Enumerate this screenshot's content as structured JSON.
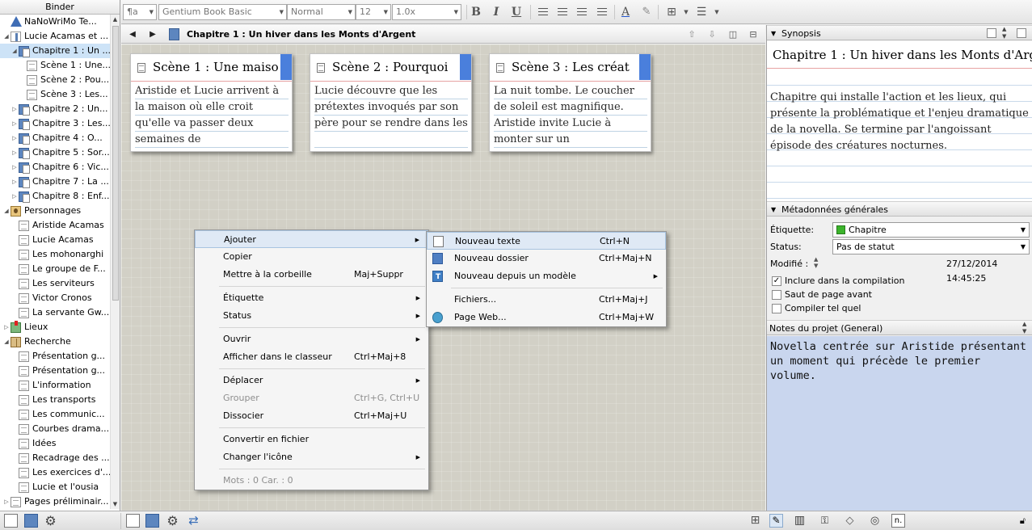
{
  "binder": {
    "header": "Binder",
    "items": [
      {
        "label": "NaNoWriMo Te...",
        "indent": 0,
        "arrow": "",
        "icon": "project"
      },
      {
        "label": "Lucie Acamas et ...",
        "indent": 0,
        "arrow": "◢",
        "icon": "draft"
      },
      {
        "label": "Chapitre 1 : Un ...",
        "indent": 1,
        "arrow": "◢",
        "icon": "folder-doc",
        "selected": true
      },
      {
        "label": "Scène 1 : Une...",
        "indent": 2,
        "arrow": "",
        "icon": "doc"
      },
      {
        "label": "Scène 2 : Pou...",
        "indent": 2,
        "arrow": "",
        "icon": "doc"
      },
      {
        "label": "Scène 3 : Les...",
        "indent": 2,
        "arrow": "",
        "icon": "doc"
      },
      {
        "label": "Chapitre 2 : Un...",
        "indent": 1,
        "arrow": "▷",
        "icon": "folder-doc"
      },
      {
        "label": "Chapitre 3 : Les...",
        "indent": 1,
        "arrow": "▷",
        "icon": "folder-doc"
      },
      {
        "label": "Chapitre 4 : O...",
        "indent": 1,
        "arrow": "▷",
        "icon": "folder-doc"
      },
      {
        "label": "Chapitre 5 : Sor...",
        "indent": 1,
        "arrow": "▷",
        "icon": "folder-doc"
      },
      {
        "label": "Chapitre 6 : Vic...",
        "indent": 1,
        "arrow": "▷",
        "icon": "folder-doc"
      },
      {
        "label": "Chapitre 7 : La ...",
        "indent": 1,
        "arrow": "▷",
        "icon": "folder-doc"
      },
      {
        "label": "Chapitre 8 : Enf...",
        "indent": 1,
        "arrow": "▷",
        "icon": "folder-doc"
      },
      {
        "label": "Personnages",
        "indent": 0,
        "arrow": "◢",
        "icon": "people"
      },
      {
        "label": "Aristide Acamas",
        "indent": 1,
        "arrow": "",
        "icon": "doc"
      },
      {
        "label": "Lucie Acamas",
        "indent": 1,
        "arrow": "",
        "icon": "doc"
      },
      {
        "label": "Les mohonarghi",
        "indent": 1,
        "arrow": "",
        "icon": "doc"
      },
      {
        "label": "Le groupe de F...",
        "indent": 1,
        "arrow": "",
        "icon": "doc"
      },
      {
        "label": "Les serviteurs",
        "indent": 1,
        "arrow": "",
        "icon": "doc"
      },
      {
        "label": "Victor Cronos",
        "indent": 1,
        "arrow": "",
        "icon": "doc"
      },
      {
        "label": "La servante Gw...",
        "indent": 1,
        "arrow": "",
        "icon": "doc"
      },
      {
        "label": "Lieux",
        "indent": 0,
        "arrow": "▷",
        "icon": "places"
      },
      {
        "label": "Recherche",
        "indent": 0,
        "arrow": "◢",
        "icon": "research"
      },
      {
        "label": "Présentation g...",
        "indent": 1,
        "arrow": "",
        "icon": "doc"
      },
      {
        "label": "Présentation g...",
        "indent": 1,
        "arrow": "",
        "icon": "doc"
      },
      {
        "label": "L'information",
        "indent": 1,
        "arrow": "",
        "icon": "doc"
      },
      {
        "label": "Les transports",
        "indent": 1,
        "arrow": "",
        "icon": "doc"
      },
      {
        "label": "Les communic...",
        "indent": 1,
        "arrow": "",
        "icon": "doc"
      },
      {
        "label": "Courbes drama...",
        "indent": 1,
        "arrow": "",
        "icon": "doc"
      },
      {
        "label": "Idées",
        "indent": 1,
        "arrow": "",
        "icon": "doc"
      },
      {
        "label": "Recadrage des ...",
        "indent": 1,
        "arrow": "",
        "icon": "doc"
      },
      {
        "label": "Les exercices d'...",
        "indent": 1,
        "arrow": "",
        "icon": "doc"
      },
      {
        "label": "Lucie et l'ousia",
        "indent": 1,
        "arrow": "",
        "icon": "doc"
      },
      {
        "label": "Pages préliminair...",
        "indent": 0,
        "arrow": "▷",
        "icon": "doc"
      }
    ]
  },
  "format_bar": {
    "paragraph_style": "¶a",
    "font": "Gentium Book Basic",
    "typeface": "Normal",
    "size": "12",
    "line_spacing": "1.0x",
    "bold": "B",
    "italic": "I",
    "underline": "U"
  },
  "editor": {
    "title": "Chapitre 1 : Un hiver dans les Monts d'Argent"
  },
  "cards": [
    {
      "title": "Scène 1 : Une maiso",
      "synopsis": "Aristide et Lucie arrivent à la maison où elle croit qu'elle va passer deux semaines de",
      "label_color": "#4a7fdc"
    },
    {
      "title": "Scène 2 : Pourquoi",
      "synopsis": "Lucie découvre que les prétextes invoqués par son père pour se rendre dans les",
      "label_color": "#4a7fdc"
    },
    {
      "title": "Scène 3 : Les créat",
      "synopsis": "La nuit tombe. Le coucher de soleil est magnifique. Aristide invite Lucie à monter sur un",
      "label_color": "#4a7fdc"
    }
  ],
  "context_menu": {
    "items": [
      {
        "label": "Ajouter",
        "shortcut": "",
        "submenu": true,
        "hover": true
      },
      {
        "label": "Copier",
        "shortcut": ""
      },
      {
        "label": "Mettre à la corbeille",
        "shortcut": "Maj+Suppr"
      },
      {
        "sep": true
      },
      {
        "label": "Étiquette",
        "shortcut": "",
        "submenu": true
      },
      {
        "label": "Status",
        "shortcut": "",
        "submenu": true
      },
      {
        "sep": true
      },
      {
        "label": "Ouvrir",
        "shortcut": "",
        "submenu": true
      },
      {
        "label": "Afficher dans le classeur",
        "shortcut": "Ctrl+Maj+8"
      },
      {
        "sep": true
      },
      {
        "label": "Déplacer",
        "shortcut": "",
        "submenu": true
      },
      {
        "label": "Grouper",
        "shortcut": "Ctrl+G, Ctrl+U",
        "disabled": true
      },
      {
        "label": "Dissocier",
        "shortcut": "Ctrl+Maj+U"
      },
      {
        "sep": true
      },
      {
        "label": "Convertir en fichier",
        "shortcut": ""
      },
      {
        "label": "Changer l'icône",
        "shortcut": "",
        "submenu": true
      },
      {
        "sep": true
      },
      {
        "label": "Mots : 0     Car. : 0",
        "shortcut": "",
        "disabled": true
      }
    ]
  },
  "submenu": {
    "items": [
      {
        "label": "Nouveau texte",
        "shortcut": "Ctrl+N",
        "icon": "new-text",
        "hover": true
      },
      {
        "label": "Nouveau dossier",
        "shortcut": "Ctrl+Maj+N",
        "icon": "new-folder"
      },
      {
        "label": "Nouveau depuis un modèle",
        "shortcut": "",
        "icon": "template",
        "submenu": true
      },
      {
        "sep": true
      },
      {
        "label": "Fichiers...",
        "shortcut": "Ctrl+Maj+J",
        "icon": ""
      },
      {
        "label": "Page Web...",
        "shortcut": "Ctrl+Maj+W",
        "icon": "web"
      }
    ]
  },
  "inspector": {
    "synopsis_header": "Synopsis",
    "synopsis_title": "Chapitre 1 : Un hiver dans les Monts d'Arg",
    "synopsis_text": "Chapitre qui installe l'action et les lieux, qui présente la problématique et l'enjeu dramatique de la novella. Se termine par l'angoissant épisode des créatures nocturnes.",
    "meta_header": "Métadonnées générales",
    "label_caption": "Étiquette:",
    "label_value": "Chapitre",
    "label_color": "#3cb42c",
    "status_caption": "Status:",
    "status_value": "Pas de statut",
    "modified_caption": "Modifié :",
    "modified_value": "27/12/2014 14:45:25",
    "checkboxes": [
      {
        "label": "Inclure dans la compilation",
        "checked": true
      },
      {
        "label": "Saut de page avant",
        "checked": false
      },
      {
        "label": "Compiler tel quel",
        "checked": false
      }
    ],
    "notes_header": "Notes du projet (General)",
    "notes_text": "Novella centrée sur Aristide présentant un moment qui précède le premier volume."
  }
}
